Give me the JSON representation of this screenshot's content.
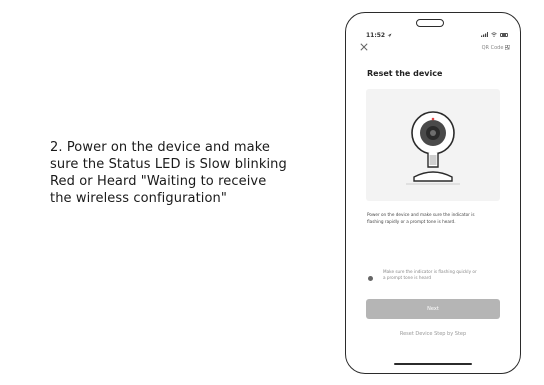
{
  "instruction": {
    "lines": [
      "2. Power on the device and make",
      "sure the Status LED is Slow blinking",
      "Red or Heard \"Waiting to receive",
      "the wireless configuration\""
    ]
  },
  "phone": {
    "status_time": "11:52",
    "qr_code_label": "QR Code",
    "title": "Reset the device",
    "description_lines": [
      "Power on the device and make sure the indicator is",
      "flashing rapidly or a prompt tone is heard."
    ],
    "confirm_lines": [
      "Make sure the indicator is flashing quickly or",
      "a prompt tone is heard"
    ],
    "next_label": "Next",
    "step_link": "Reset Device Step by Step",
    "icons": {
      "close": "close-icon",
      "qr": "qr-code-icon",
      "camera": "camera-illustration"
    },
    "colors": {
      "button": "#b5b5b5",
      "panel": "#f3f3f3"
    }
  }
}
